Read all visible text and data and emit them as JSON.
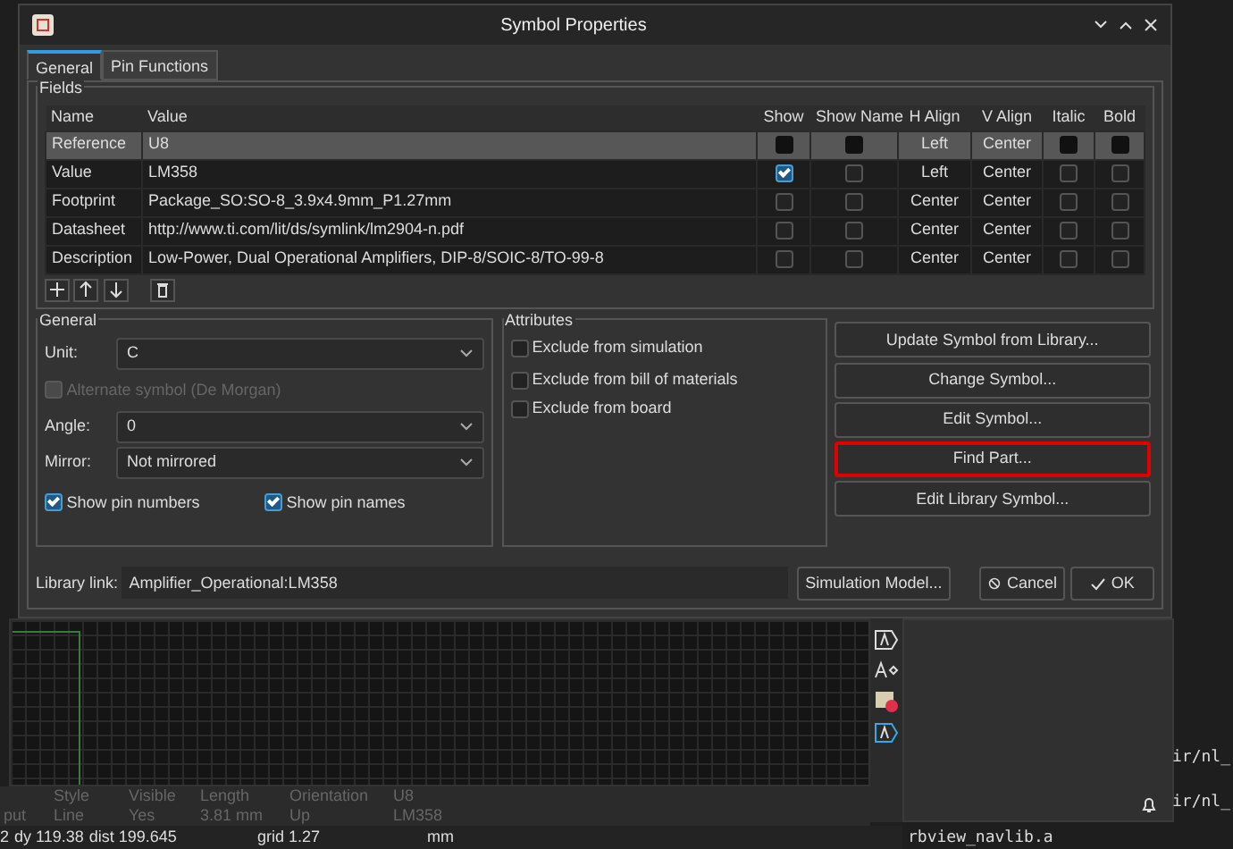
{
  "window": {
    "title": "Symbol Properties"
  },
  "tabs": [
    {
      "label": "General",
      "selected": true
    },
    {
      "label": "Pin Functions",
      "selected": false
    }
  ],
  "fields": {
    "title": "Fields",
    "columns": [
      "Name",
      "Value",
      "Show",
      "Show Name",
      "H Align",
      "V Align",
      "Italic",
      "Bold"
    ],
    "rows": [
      {
        "name": "Reference",
        "value": "U8",
        "show": false,
        "show_name": false,
        "h_align": "Left",
        "v_align": "Center",
        "italic": false,
        "bold": false,
        "selected": true
      },
      {
        "name": "Value",
        "value": "LM358",
        "show": true,
        "show_name": false,
        "h_align": "Left",
        "v_align": "Center",
        "italic": false,
        "bold": false,
        "selected": false
      },
      {
        "name": "Footprint",
        "value": "Package_SO:SO-8_3.9x4.9mm_P1.27mm",
        "show": false,
        "show_name": false,
        "h_align": "Center",
        "v_align": "Center",
        "italic": false,
        "bold": false,
        "selected": false
      },
      {
        "name": "Datasheet",
        "value": "http://www.ti.com/lit/ds/symlink/lm2904-n.pdf",
        "show": false,
        "show_name": false,
        "h_align": "Center",
        "v_align": "Center",
        "italic": false,
        "bold": false,
        "selected": false
      },
      {
        "name": "Description",
        "value": "Low-Power, Dual Operational Amplifiers, DIP-8/SOIC-8/TO-99-8",
        "show": false,
        "show_name": false,
        "h_align": "Center",
        "v_align": "Center",
        "italic": false,
        "bold": false,
        "selected": false
      }
    ]
  },
  "general": {
    "title": "General",
    "unit": {
      "label": "Unit:",
      "value": "C"
    },
    "alternate": {
      "label": "Alternate symbol (De Morgan)",
      "checked": false,
      "disabled": true
    },
    "angle": {
      "label": "Angle:",
      "value": "0"
    },
    "mirror": {
      "label": "Mirror:",
      "value": "Not mirrored"
    },
    "toggles": [
      {
        "label": "Show pin numbers",
        "checked": true
      },
      {
        "label": "Show pin names",
        "checked": true
      }
    ]
  },
  "attributes": {
    "title": "Attributes",
    "items": [
      {
        "label": "Exclude from simulation",
        "checked": false
      },
      {
        "label": "Exclude from bill of materials",
        "checked": false
      },
      {
        "label": "Exclude from board",
        "checked": false
      }
    ]
  },
  "actions": [
    {
      "label": "Update Symbol from Library...",
      "highlighted": false
    },
    {
      "label": "Change Symbol...",
      "highlighted": false
    },
    {
      "label": "Edit Symbol...",
      "highlighted": false
    },
    {
      "label": "Find Part...",
      "highlighted": true
    },
    {
      "label": "Edit Library Symbol...",
      "highlighted": false
    }
  ],
  "library_link": {
    "label": "Library link:",
    "value": "Amplifier_Operational:LM358"
  },
  "footer_buttons": [
    {
      "label": "Simulation Model...",
      "kind": "plain"
    },
    {
      "label": "Cancel",
      "kind": "cancel"
    },
    {
      "label": "OK",
      "kind": "ok"
    }
  ],
  "properties": {
    "headers": [
      "Style",
      "Visible",
      "Length",
      "Orientation",
      "U8"
    ],
    "values": [
      "put",
      "Line",
      "Yes",
      "3.81 mm",
      "Up",
      "LM358"
    ]
  },
  "status_bar": [
    "2",
    "dy 119.38",
    "dist 199.645",
    "grid 1.27",
    "mm"
  ],
  "terminal": [
    "ir/nl_",
    "ir/nl_",
    "rbview_navlib.a"
  ]
}
